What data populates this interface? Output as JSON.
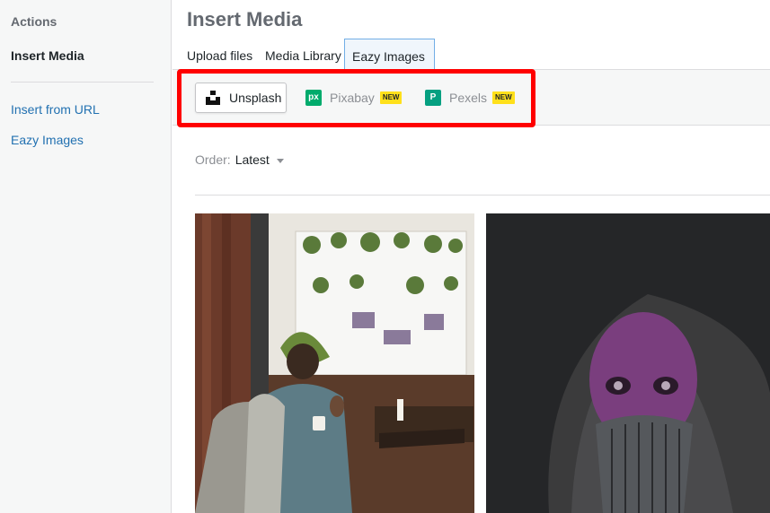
{
  "sidebar": {
    "heading": "Actions",
    "active_item": "Insert Media",
    "links": [
      "Insert from URL",
      "Eazy Images"
    ]
  },
  "main": {
    "title": "Insert Media",
    "tabs": [
      "Upload files",
      "Media Library",
      "Eazy Images"
    ],
    "active_tab": "Eazy Images",
    "providers": [
      {
        "label": "Unsplash",
        "icon": "unsplash-icon",
        "badge": ""
      },
      {
        "label": "Pixabay",
        "icon": "pixabay-icon",
        "badge": "NEW",
        "icon_text": "px"
      },
      {
        "label": "Pexels",
        "icon": "pexels-icon",
        "badge": "NEW",
        "icon_text": "P"
      }
    ],
    "order": {
      "label": "Order:",
      "value": "Latest"
    }
  },
  "colors": {
    "accent": "#2271b1",
    "highlight": "#ff0000",
    "pixabay": "#00ab6c",
    "pexels": "#05a081",
    "badge": "#ffe01b"
  }
}
